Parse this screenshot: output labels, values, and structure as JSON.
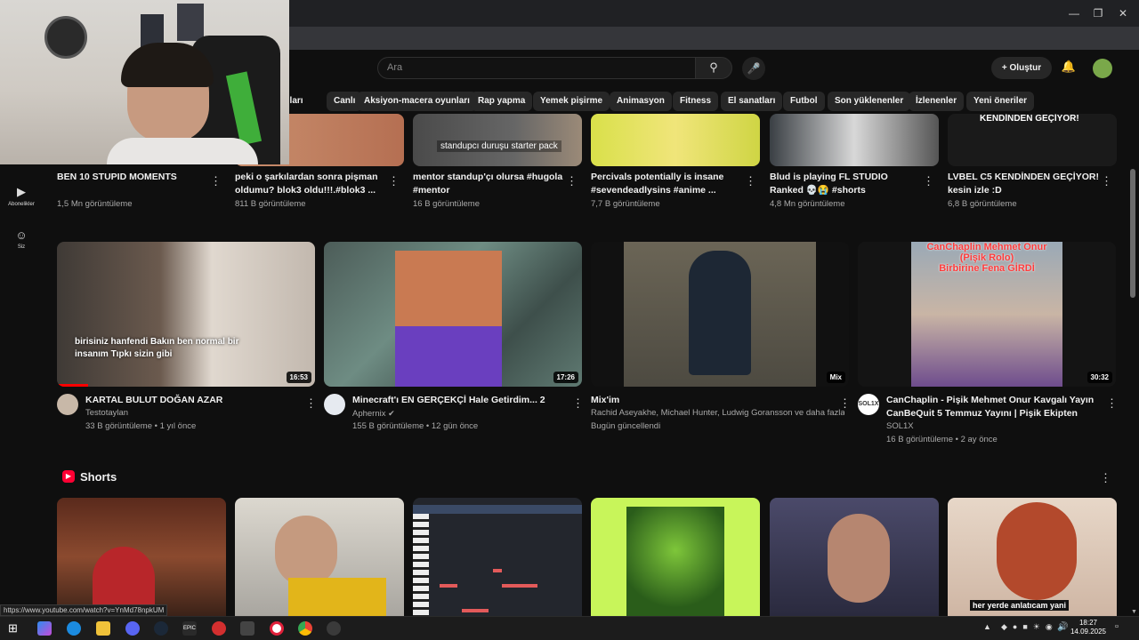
{
  "header": {
    "search_placeholder": "Ara",
    "create_label": "Oluştur"
  },
  "chips": [
    "ılları",
    "Canlı",
    "Aksiyon-macera oyunları",
    "Rap yapma",
    "Yemek pişirme",
    "Animasyon",
    "Fitness",
    "El sanatları",
    "Futbol",
    "Son yüklenenler",
    "İzlenenler",
    "Yeni öneriler"
  ],
  "sidebar": {
    "subscriptions": "Abonelikler",
    "you": "Siz"
  },
  "row1": [
    {
      "title": "BEN 10 STUPID MOMENTS",
      "meta": "1,5 Mn görüntüleme"
    },
    {
      "title": "peki o şarkılardan sonra pişman oldumu? blok3 oldu!!!.#blok3 ...",
      "meta": "811 B görüntüleme"
    },
    {
      "title": "mentor standup'çı olursa #hugola #mentor",
      "meta": "16 B görüntüleme",
      "overlay": "standupcı duruşu starter pack"
    },
    {
      "title": "Percivals potentially is insane #sevendeadlysins #anime ...",
      "meta": "7,7 B görüntüleme"
    },
    {
      "title": "Blud is playing FL STUDIO Ranked 💀😭 #shorts",
      "meta": "4,8 Mn görüntüleme"
    },
    {
      "title": "LVBEL C5 KENDİNDEN GEÇİYOR! kesin izle :D",
      "meta": "6,8 B görüntüleme",
      "overlay": "KENDİNDEN GEÇİYOR!"
    }
  ],
  "row2": [
    {
      "title": "KARTAL BULUT DOĞAN AZAR",
      "channel": "Testotaylan",
      "meta": "33 B görüntüleme • 1 yıl önce",
      "duration": "16:53",
      "caption": "birisiniz hanfendi Bakın ben normal bir insanım Tıpkı sizin gibi"
    },
    {
      "title": "Minecraft'ı EN GERÇEKÇİ Hale Getirdim... 2",
      "channel": "Aphernix",
      "meta": "155 B görüntüleme • 12 gün önce",
      "duration": "17:26"
    },
    {
      "title": "Mix'im",
      "channel": "Rachid Aseyakhe, Michael Hunter, Ludwig Goransson ve daha fazlası",
      "meta": "Bugün güncellendi",
      "duration": "Mix"
    },
    {
      "title": "CanChaplin - Pişik Mehmet Onur Kavgalı Yayın CanBeQuit 5 Temmuz Yayını | Pişik Ekipten Gidiy...",
      "channel": "SOL1X",
      "meta": "16 B görüntüleme • 2 ay önce",
      "duration": "30:32",
      "thumb_line1": "CanChaplin Mehmet Onur",
      "thumb_line2": "(Pişik Rolo)",
      "thumb_line3": "Birbirine Fena GİRDİ",
      "avatar_text": "SOL1X"
    }
  ],
  "shorts": {
    "heading": "Shorts",
    "subtitle": "her yerde anlatıcam yani"
  },
  "status_url": "https://www.youtube.com/watch?v=YnMd78npkUM",
  "taskbar": {
    "time": "18:27",
    "date": "14.09.2025"
  }
}
